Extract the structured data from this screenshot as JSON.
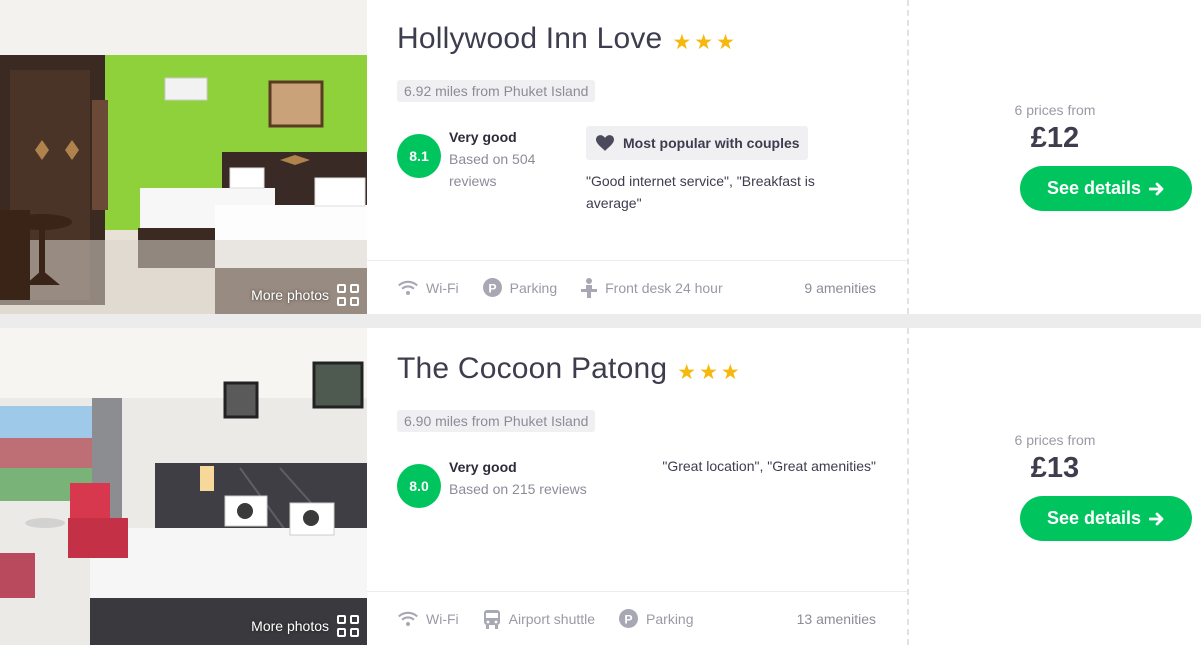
{
  "hotels": [
    {
      "name": "Hollywood Inn Love",
      "stars": 3,
      "distance": "6.92 miles from Phuket Island",
      "score": "8.1",
      "rating_label": "Very good",
      "rating_reviews": [
        "Based on 504",
        "reviews"
      ],
      "badge": "Most popular with couples",
      "quote": [
        "\"Good internet service\", \"Breakfast is",
        "average\""
      ],
      "more_photos": "More photos",
      "amenities": [
        "Wi-Fi",
        "Parking",
        "Front desk 24 hour"
      ],
      "amenities_count": "9 amenities",
      "prices_from": "6 prices from",
      "price": "£12",
      "button": "See details"
    },
    {
      "name": "The Cocoon Patong",
      "stars": 3,
      "distance": "6.90 miles from Phuket Island",
      "score": "8.0",
      "rating_label": "Very good",
      "rating_reviews": [
        "Based on 215 reviews"
      ],
      "quote": [
        "\"Great location\", \"Great amenities\""
      ],
      "more_photos": "More photos",
      "amenities": [
        "Wi-Fi",
        "Airport shuttle",
        "Parking"
      ],
      "amenities_count": "13 amenities",
      "prices_from": "6 prices from",
      "price": "£13",
      "button": "See details"
    }
  ],
  "colors": {
    "accent_green": "#00c55e",
    "star": "#f6b80d"
  },
  "icons": [
    "wifi-icon",
    "parking-icon",
    "front-desk-icon",
    "shuttle-icon",
    "heart-icon",
    "arrow-right-icon",
    "grid-icon",
    "star-icon"
  ]
}
